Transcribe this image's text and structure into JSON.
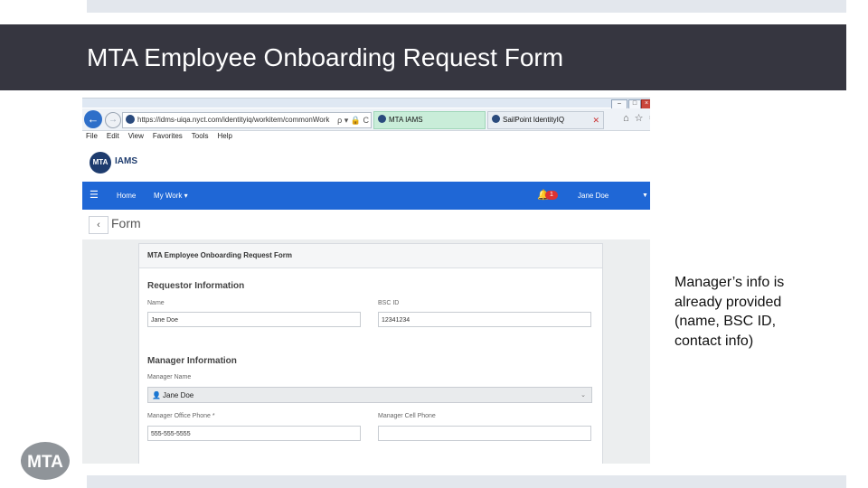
{
  "slide": {
    "title": "MTA Employee Onboarding Request Form",
    "note": "Manager’s info is already provided (name, BSC ID, contact info)"
  },
  "browser": {
    "address": "https://idms-uiqa.nyct.com/identityiq/workitem/commonWork",
    "address_tail": "ρ ▾ 🔒 C",
    "tabs": [
      {
        "label": "MTA IAMS",
        "active": true
      },
      {
        "label": "SailPoint IdentityIQ",
        "active": false
      }
    ],
    "tab_close": "✕",
    "menu": [
      "File",
      "Edit",
      "View",
      "Favorites",
      "Tools",
      "Help"
    ]
  },
  "app": {
    "logo_badge": "MTA",
    "logo_text": "IAMS",
    "nav": {
      "home": "Home",
      "my_work": "My Work ▾",
      "notification_count": "1",
      "user": "Jane Doe"
    },
    "page_title": "Form",
    "form": {
      "header": "MTA Employee Onboarding Request Form",
      "requestor_title": "Requestor Information",
      "name_label": "Name",
      "name_value": "Jane Doe",
      "bsc_label": "BSC ID",
      "bsc_value": "12341234",
      "manager_title": "Manager Information",
      "manager_name_label": "Manager Name",
      "manager_name_value": "Jane Doe",
      "office_phone_label": "Manager Office Phone *",
      "office_phone_value": "555-555-5555",
      "cell_phone_label": "Manager Cell Phone",
      "cell_phone_value": ""
    }
  },
  "colors": {
    "title_bar": "#363640",
    "app_nav": "#1f67d6",
    "brand_navy": "#1e3c6e"
  }
}
